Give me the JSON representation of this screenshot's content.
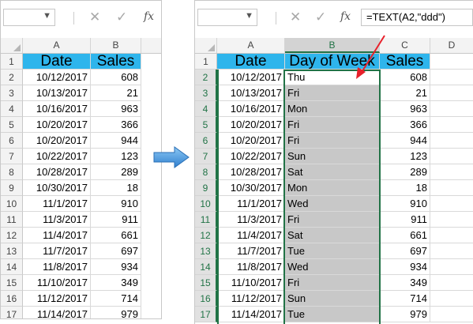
{
  "left": {
    "formula_bar": {
      "cancel_icon": "✕",
      "enter_icon": "✓",
      "fx": "fx",
      "formula": ""
    },
    "columns": [
      "A",
      "B"
    ],
    "rows": [
      {
        "n": "1",
        "a": "Date",
        "b": "Sales"
      },
      {
        "n": "2",
        "a": "10/12/2017",
        "b": "608"
      },
      {
        "n": "3",
        "a": "10/13/2017",
        "b": "21"
      },
      {
        "n": "4",
        "a": "10/16/2017",
        "b": "963"
      },
      {
        "n": "5",
        "a": "10/20/2017",
        "b": "366"
      },
      {
        "n": "6",
        "a": "10/20/2017",
        "b": "944"
      },
      {
        "n": "7",
        "a": "10/22/2017",
        "b": "123"
      },
      {
        "n": "8",
        "a": "10/28/2017",
        "b": "289"
      },
      {
        "n": "9",
        "a": "10/30/2017",
        "b": "18"
      },
      {
        "n": "10",
        "a": "11/1/2017",
        "b": "910"
      },
      {
        "n": "11",
        "a": "11/3/2017",
        "b": "911"
      },
      {
        "n": "12",
        "a": "11/4/2017",
        "b": "661"
      },
      {
        "n": "13",
        "a": "11/7/2017",
        "b": "697"
      },
      {
        "n": "14",
        "a": "11/8/2017",
        "b": "934"
      },
      {
        "n": "15",
        "a": "11/10/2017",
        "b": "349"
      },
      {
        "n": "16",
        "a": "11/12/2017",
        "b": "714"
      },
      {
        "n": "17",
        "a": "11/14/2017",
        "b": "979"
      }
    ]
  },
  "right": {
    "formula_bar": {
      "cancel_icon": "✕",
      "enter_icon": "✓",
      "fx": "fx",
      "formula": "=TEXT(A2,\"ddd\")"
    },
    "columns": [
      "A",
      "B",
      "C",
      "D"
    ],
    "rows": [
      {
        "n": "1",
        "a": "Date",
        "b": "Day of Week",
        "c": "Sales"
      },
      {
        "n": "2",
        "a": "10/12/2017",
        "b": "Thu",
        "c": "608"
      },
      {
        "n": "3",
        "a": "10/13/2017",
        "b": "Fri",
        "c": "21"
      },
      {
        "n": "4",
        "a": "10/16/2017",
        "b": "Mon",
        "c": "963"
      },
      {
        "n": "5",
        "a": "10/20/2017",
        "b": "Fri",
        "c": "366"
      },
      {
        "n": "6",
        "a": "10/20/2017",
        "b": "Fri",
        "c": "944"
      },
      {
        "n": "7",
        "a": "10/22/2017",
        "b": "Sun",
        "c": "123"
      },
      {
        "n": "8",
        "a": "10/28/2017",
        "b": "Sat",
        "c": "289"
      },
      {
        "n": "9",
        "a": "10/30/2017",
        "b": "Mon",
        "c": "18"
      },
      {
        "n": "10",
        "a": "11/1/2017",
        "b": "Wed",
        "c": "910"
      },
      {
        "n": "11",
        "a": "11/3/2017",
        "b": "Fri",
        "c": "911"
      },
      {
        "n": "12",
        "a": "11/4/2017",
        "b": "Sat",
        "c": "661"
      },
      {
        "n": "13",
        "a": "11/7/2017",
        "b": "Tue",
        "c": "697"
      },
      {
        "n": "14",
        "a": "11/8/2017",
        "b": "Wed",
        "c": "934"
      },
      {
        "n": "15",
        "a": "11/10/2017",
        "b": "Fri",
        "c": "349"
      },
      {
        "n": "16",
        "a": "11/12/2017",
        "b": "Sun",
        "c": "714"
      },
      {
        "n": "17",
        "a": "11/14/2017",
        "b": "Tue",
        "c": "979"
      }
    ]
  },
  "colors": {
    "header_fill": "#2eb5ec",
    "selection": "#217346",
    "shade": "#c8c8c8",
    "arrow": "#3a8fd6",
    "annotation_arrow": "#e8202a"
  }
}
